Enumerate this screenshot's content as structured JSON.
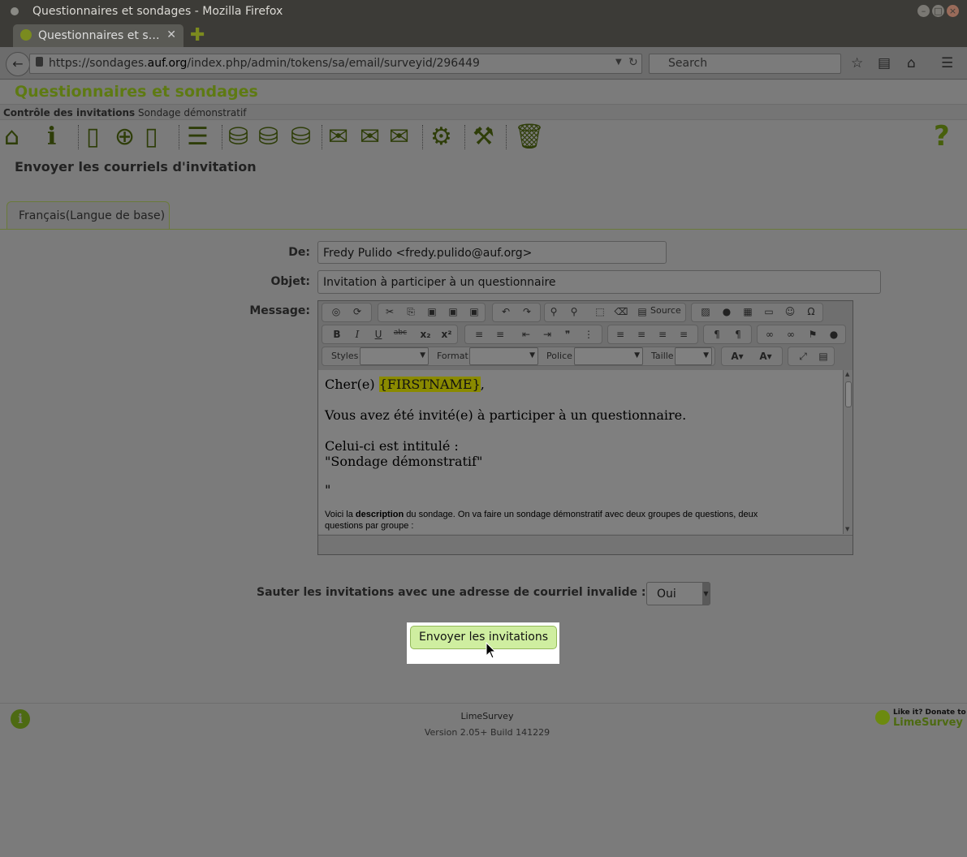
{
  "window": {
    "title": "Questionnaires et sondages - Mozilla Firefox"
  },
  "browser": {
    "tab_label": "Questionnaires et s…",
    "url_prefix": "https://sondages.",
    "url_domain": "auf.org",
    "url_path": "/index.php/admin/tokens/sa/email/surveyid/296449",
    "search_placeholder": "Search"
  },
  "app": {
    "brand": "Questionnaires et sondages",
    "breadcrumb": {
      "section": "Contrôle des invitations",
      "survey": "Sondage démonstratif"
    },
    "toolbar_icons": [
      "home-icon",
      "info-icon",
      "page-icon",
      "add-icon",
      "add-page-icon",
      "list-icon",
      "csv-export-icon",
      "ldap-icon",
      "csv-import-icon",
      "invite-icon",
      "remind-icon",
      "bounce-icon",
      "settings-icon",
      "tools-icon",
      "delete-icon"
    ],
    "help": "?"
  },
  "form": {
    "page_heading": "Envoyer les courriels d'invitation",
    "language_tab": "Français(Langue de base)",
    "from_label": "De:",
    "from_value": "Fredy Pulido <fredy.pulido@auf.org>",
    "subject_label": "Objet:",
    "subject_value": "Invitation à participer à un questionnaire",
    "message_label": "Message:",
    "editor": {
      "source_label": "Source",
      "styles_label": "Styles",
      "format_label": "Format",
      "font_label": "Police",
      "size_label": "Taille",
      "body": {
        "greeting_prefix": "Cher(e) ",
        "firstname_tag": "{FIRSTNAME}",
        "greeting_suffix": ",",
        "line1": "Vous avez été invité(e) à participer à un questionnaire.",
        "line2": "Celui-ci est intitulé :",
        "line3": "\"Sondage démonstratif\"",
        "line4": "\"",
        "desc_prefix": "Voici la ",
        "desc_bold": "description",
        "desc_suffix": " du sondage. On va faire un sondage démonstratif avec deux groupes de questions, deux",
        "desc_line2": "questions par groupe :"
      }
    },
    "skip_label": "Sauter les invitations avec une adresse de courriel invalide :",
    "skip_value": "Oui",
    "send_button": "Envoyer les invitations"
  },
  "footer": {
    "product": "LimeSurvey",
    "version": "Version 2.05+ Build 141229",
    "donate_line1": "Like it? Donate to",
    "donate_line2": "LimeSurvey"
  }
}
